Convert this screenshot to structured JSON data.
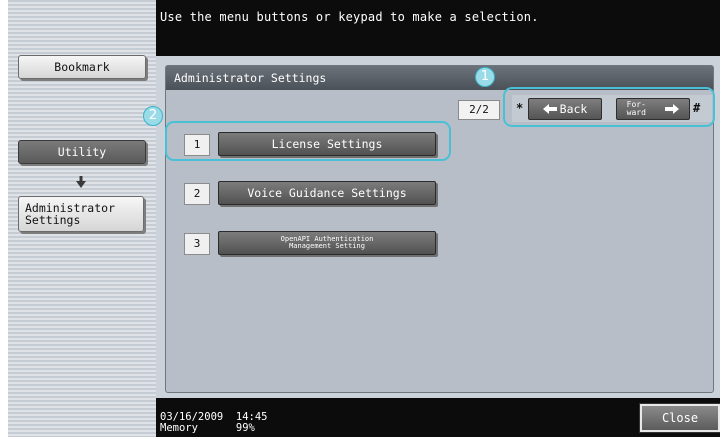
{
  "header": {
    "message": "Use the menu buttons or keypad to make a selection."
  },
  "sidebar": {
    "bookmark_label": "Bookmark",
    "utility_label": "Utility",
    "admin_label_line1": "Administrator",
    "admin_label_line2": "Settings"
  },
  "panel": {
    "title": "Administrator Settings",
    "page_indicator": "2/2"
  },
  "nav": {
    "star_key": "*",
    "back_label": "Back",
    "forward_label_line1": "For-",
    "forward_label_line2": "ward",
    "hash_key": "#"
  },
  "menu": {
    "items": [
      {
        "number": "1",
        "label": "License Settings"
      },
      {
        "number": "2",
        "label": "Voice Guidance Settings"
      },
      {
        "number": "3",
        "label_line1": "OpenAPI Authentication",
        "label_line2": "Management Setting"
      }
    ]
  },
  "footer": {
    "date": "03/16/2009",
    "time": "14:45",
    "memory_label": "Memory",
    "memory_value": "99%",
    "close_label": "Close"
  },
  "callouts": {
    "one": "1",
    "two": "2"
  },
  "colors": {
    "highlight": "#48c1d6",
    "button": "#5f5f5f",
    "panel": "#b7bec8"
  }
}
